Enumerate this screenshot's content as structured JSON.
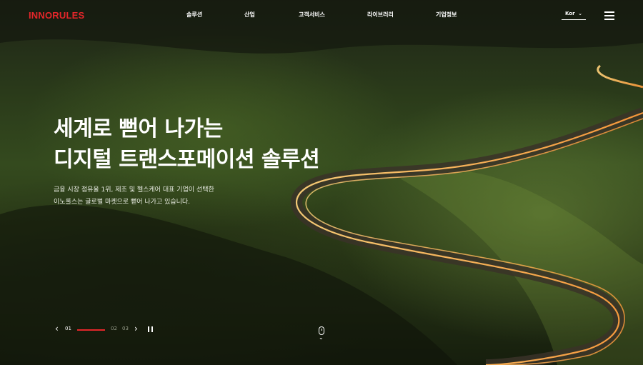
{
  "brand": {
    "logo_text": "INNORULES",
    "logo_color": "#e3262a"
  },
  "nav": {
    "items": [
      {
        "label": "솔루션"
      },
      {
        "label": "산업"
      },
      {
        "label": "고객서비스"
      },
      {
        "label": "라이브러리"
      },
      {
        "label": "기업정보"
      }
    ],
    "language": "Kor"
  },
  "hero": {
    "headline_line1": "세계로 뻗어 나가는",
    "headline_line2": "디지털 트랜스포메이션 솔루션",
    "desc_line1": "금융 시장 점유율 1위, 제조 및 헬스케어 대표 기업이 선택한",
    "desc_line2": "이노룰스는 글로벌 마켓으로 뻗어 나가고 있습니다."
  },
  "slider": {
    "current": "01",
    "slides": [
      "01",
      "02",
      "03"
    ],
    "progress": 1.0,
    "accent": "#e3262a"
  },
  "icons": {
    "prev": "chevron-left-icon",
    "next": "chevron-right-icon",
    "pause": "pause-icon",
    "menu": "hamburger-icon",
    "scroll": "mouse-scroll-icon"
  }
}
